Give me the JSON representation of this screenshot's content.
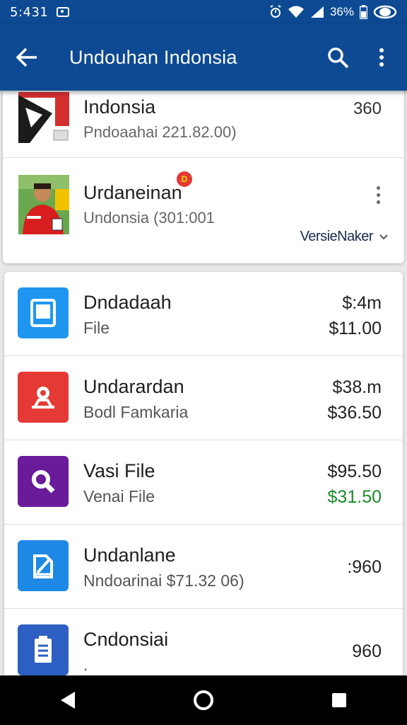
{
  "status_bar": {
    "time": "5:431",
    "battery": "36%",
    "icons": [
      "notification-icon",
      "alarm-icon",
      "wifi-icon",
      "signal-icon",
      "battery-icon",
      "eye-icon"
    ]
  },
  "appbar": {
    "title": "Undouhan Indonsia",
    "icons": [
      "back-arrow-icon",
      "search-icon",
      "more-vert-icon"
    ],
    "color": "#0d4a93"
  },
  "top_card": {
    "rows": [
      {
        "title": "Indonsia",
        "subtitle": "Pndoaahai 221.82.00)",
        "value": "360",
        "thumb": "flag-logo-thumbnail"
      },
      {
        "title": "Urdaneinan",
        "subtitle": "Undonsia (301:001",
        "badge": "D",
        "thumb": "person-photo-thumbnail",
        "dropdown": "VersieNaker"
      }
    ]
  },
  "list": {
    "items": [
      {
        "name": "Dndadaah",
        "sub": "File",
        "price1": "$:4m",
        "price2": "$11.00",
        "icon": "tablet-icon",
        "icon_color": "#1e96f0"
      },
      {
        "name": "Undarardan",
        "sub": "Bodl Famkaria",
        "price1": "$38.m",
        "price2": "$36.50",
        "icon": "webcam-icon",
        "icon_color": "#e53935"
      },
      {
        "name": "Vasi File",
        "sub": "Venai File",
        "price1": "$95.50",
        "price2": "$31.50",
        "price2_color": "#1b8a2a",
        "icon": "magnifier-icon",
        "icon_color": "#6a1b9a"
      },
      {
        "name": "Undanlane",
        "sub": "Nndoarinai $71.32 06)",
        "price1": ":960",
        "icon": "edit-document-icon",
        "icon_color": "#1e88e5"
      },
      {
        "name": "Cndonsiai",
        "sub": ".",
        "price1": "960",
        "icon": "document-list-icon",
        "icon_color": "#2d5fc2"
      }
    ]
  },
  "nav": {
    "icons": [
      "back-triangle-icon",
      "home-circle-icon",
      "recents-square-icon"
    ]
  }
}
